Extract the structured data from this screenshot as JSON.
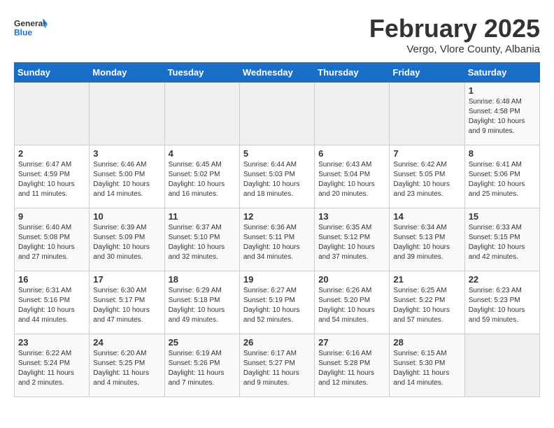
{
  "logo": {
    "line1": "General",
    "line2": "Blue"
  },
  "title": "February 2025",
  "subtitle": "Vergo, Vlore County, Albania",
  "days_of_week": [
    "Sunday",
    "Monday",
    "Tuesday",
    "Wednesday",
    "Thursday",
    "Friday",
    "Saturday"
  ],
  "weeks": [
    [
      {
        "day": "",
        "info": ""
      },
      {
        "day": "",
        "info": ""
      },
      {
        "day": "",
        "info": ""
      },
      {
        "day": "",
        "info": ""
      },
      {
        "day": "",
        "info": ""
      },
      {
        "day": "",
        "info": ""
      },
      {
        "day": "1",
        "info": "Sunrise: 6:48 AM\nSunset: 4:58 PM\nDaylight: 10 hours\nand 9 minutes."
      }
    ],
    [
      {
        "day": "2",
        "info": "Sunrise: 6:47 AM\nSunset: 4:59 PM\nDaylight: 10 hours\nand 11 minutes."
      },
      {
        "day": "3",
        "info": "Sunrise: 6:46 AM\nSunset: 5:00 PM\nDaylight: 10 hours\nand 14 minutes."
      },
      {
        "day": "4",
        "info": "Sunrise: 6:45 AM\nSunset: 5:02 PM\nDaylight: 10 hours\nand 16 minutes."
      },
      {
        "day": "5",
        "info": "Sunrise: 6:44 AM\nSunset: 5:03 PM\nDaylight: 10 hours\nand 18 minutes."
      },
      {
        "day": "6",
        "info": "Sunrise: 6:43 AM\nSunset: 5:04 PM\nDaylight: 10 hours\nand 20 minutes."
      },
      {
        "day": "7",
        "info": "Sunrise: 6:42 AM\nSunset: 5:05 PM\nDaylight: 10 hours\nand 23 minutes."
      },
      {
        "day": "8",
        "info": "Sunrise: 6:41 AM\nSunset: 5:06 PM\nDaylight: 10 hours\nand 25 minutes."
      }
    ],
    [
      {
        "day": "9",
        "info": "Sunrise: 6:40 AM\nSunset: 5:08 PM\nDaylight: 10 hours\nand 27 minutes."
      },
      {
        "day": "10",
        "info": "Sunrise: 6:39 AM\nSunset: 5:09 PM\nDaylight: 10 hours\nand 30 minutes."
      },
      {
        "day": "11",
        "info": "Sunrise: 6:37 AM\nSunset: 5:10 PM\nDaylight: 10 hours\nand 32 minutes."
      },
      {
        "day": "12",
        "info": "Sunrise: 6:36 AM\nSunset: 5:11 PM\nDaylight: 10 hours\nand 34 minutes."
      },
      {
        "day": "13",
        "info": "Sunrise: 6:35 AM\nSunset: 5:12 PM\nDaylight: 10 hours\nand 37 minutes."
      },
      {
        "day": "14",
        "info": "Sunrise: 6:34 AM\nSunset: 5:13 PM\nDaylight: 10 hours\nand 39 minutes."
      },
      {
        "day": "15",
        "info": "Sunrise: 6:33 AM\nSunset: 5:15 PM\nDaylight: 10 hours\nand 42 minutes."
      }
    ],
    [
      {
        "day": "16",
        "info": "Sunrise: 6:31 AM\nSunset: 5:16 PM\nDaylight: 10 hours\nand 44 minutes."
      },
      {
        "day": "17",
        "info": "Sunrise: 6:30 AM\nSunset: 5:17 PM\nDaylight: 10 hours\nand 47 minutes."
      },
      {
        "day": "18",
        "info": "Sunrise: 6:29 AM\nSunset: 5:18 PM\nDaylight: 10 hours\nand 49 minutes."
      },
      {
        "day": "19",
        "info": "Sunrise: 6:27 AM\nSunset: 5:19 PM\nDaylight: 10 hours\nand 52 minutes."
      },
      {
        "day": "20",
        "info": "Sunrise: 6:26 AM\nSunset: 5:20 PM\nDaylight: 10 hours\nand 54 minutes."
      },
      {
        "day": "21",
        "info": "Sunrise: 6:25 AM\nSunset: 5:22 PM\nDaylight: 10 hours\nand 57 minutes."
      },
      {
        "day": "22",
        "info": "Sunrise: 6:23 AM\nSunset: 5:23 PM\nDaylight: 10 hours\nand 59 minutes."
      }
    ],
    [
      {
        "day": "23",
        "info": "Sunrise: 6:22 AM\nSunset: 5:24 PM\nDaylight: 11 hours\nand 2 minutes."
      },
      {
        "day": "24",
        "info": "Sunrise: 6:20 AM\nSunset: 5:25 PM\nDaylight: 11 hours\nand 4 minutes."
      },
      {
        "day": "25",
        "info": "Sunrise: 6:19 AM\nSunset: 5:26 PM\nDaylight: 11 hours\nand 7 minutes."
      },
      {
        "day": "26",
        "info": "Sunrise: 6:17 AM\nSunset: 5:27 PM\nDaylight: 11 hours\nand 9 minutes."
      },
      {
        "day": "27",
        "info": "Sunrise: 6:16 AM\nSunset: 5:28 PM\nDaylight: 11 hours\nand 12 minutes."
      },
      {
        "day": "28",
        "info": "Sunrise: 6:15 AM\nSunset: 5:30 PM\nDaylight: 11 hours\nand 14 minutes."
      },
      {
        "day": "",
        "info": ""
      }
    ]
  ]
}
